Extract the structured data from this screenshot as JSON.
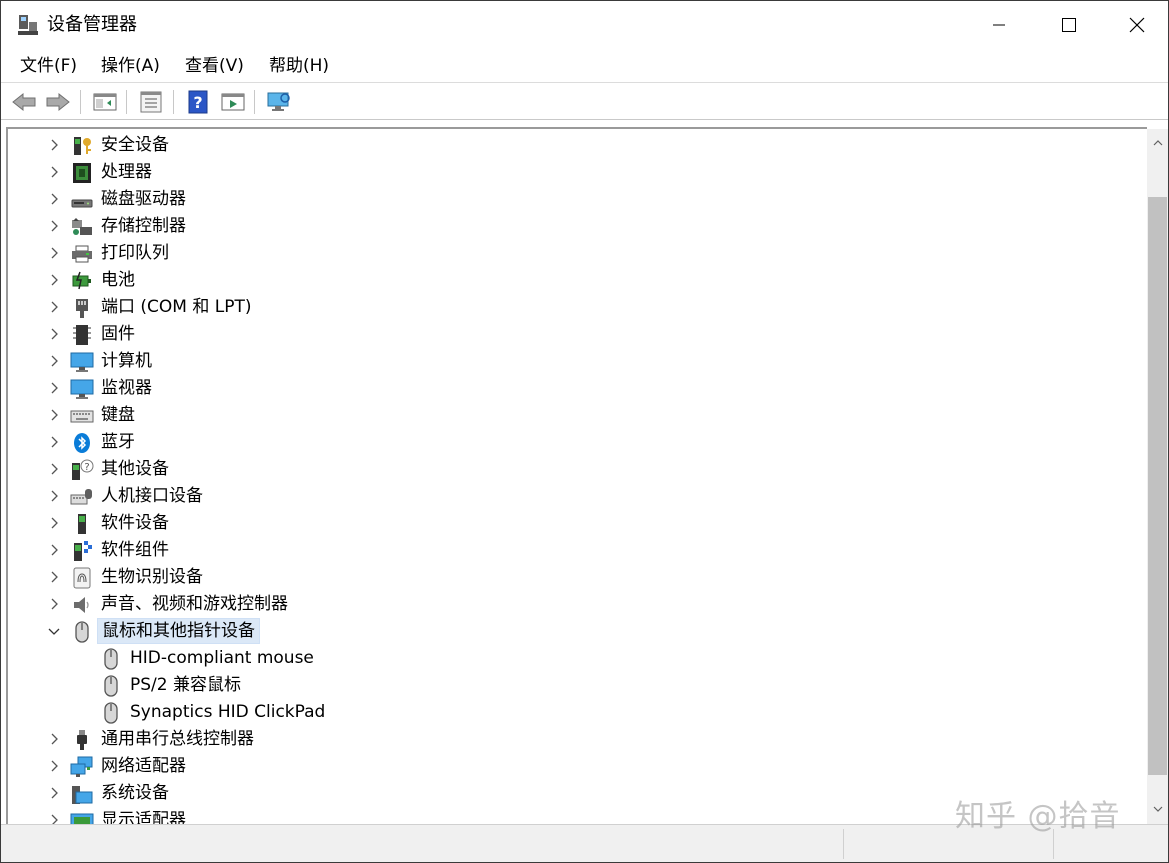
{
  "window": {
    "title": "设备管理器"
  },
  "menu": [
    "文件(F)",
    "操作(A)",
    "查看(V)",
    "帮助(H)"
  ],
  "toolbar": {
    "buttons": [
      "back-icon",
      "forward-icon",
      "show-hide-tree-icon",
      "properties-icon",
      "help-icon",
      "run-icon",
      "scan-hardware-icon"
    ]
  },
  "tree": {
    "items": [
      {
        "label": "安全设备",
        "expanded": false,
        "icon": "security-device-icon"
      },
      {
        "label": "处理器",
        "expanded": false,
        "icon": "processor-icon"
      },
      {
        "label": "磁盘驱动器",
        "expanded": false,
        "icon": "disk-drive-icon"
      },
      {
        "label": "存储控制器",
        "expanded": false,
        "icon": "storage-controller-icon"
      },
      {
        "label": "打印队列",
        "expanded": false,
        "icon": "printer-icon"
      },
      {
        "label": "电池",
        "expanded": false,
        "icon": "battery-icon"
      },
      {
        "label": "端口 (COM 和 LPT)",
        "expanded": false,
        "icon": "port-icon"
      },
      {
        "label": "固件",
        "expanded": false,
        "icon": "firmware-icon"
      },
      {
        "label": "计算机",
        "expanded": false,
        "icon": "computer-icon"
      },
      {
        "label": "监视器",
        "expanded": false,
        "icon": "monitor-icon"
      },
      {
        "label": "键盘",
        "expanded": false,
        "icon": "keyboard-icon"
      },
      {
        "label": "蓝牙",
        "expanded": false,
        "icon": "bluetooth-icon"
      },
      {
        "label": "其他设备",
        "expanded": false,
        "icon": "other-device-icon"
      },
      {
        "label": "人机接口设备",
        "expanded": false,
        "icon": "hid-icon"
      },
      {
        "label": "软件设备",
        "expanded": false,
        "icon": "software-device-icon"
      },
      {
        "label": "软件组件",
        "expanded": false,
        "icon": "software-component-icon"
      },
      {
        "label": "生物识别设备",
        "expanded": false,
        "icon": "fingerprint-icon"
      },
      {
        "label": "声音、视频和游戏控制器",
        "expanded": false,
        "icon": "speaker-icon"
      },
      {
        "label": "鼠标和其他指针设备",
        "expanded": true,
        "selected": true,
        "icon": "mouse-icon",
        "children": [
          "HID-compliant mouse",
          "PS/2 兼容鼠标",
          "Synaptics HID ClickPad"
        ]
      },
      {
        "label": "通用串行总线控制器",
        "expanded": false,
        "icon": "usb-icon"
      },
      {
        "label": "网络适配器",
        "expanded": false,
        "icon": "network-adapter-icon"
      },
      {
        "label": "系统设备",
        "expanded": false,
        "icon": "system-device-icon"
      },
      {
        "label": "显示适配器",
        "expanded": false,
        "icon": "display-adapter-icon"
      }
    ]
  },
  "watermark": "知乎 @拾音",
  "colors": {
    "selection": "#dbe8f7",
    "accent": "#0a7cd8"
  }
}
